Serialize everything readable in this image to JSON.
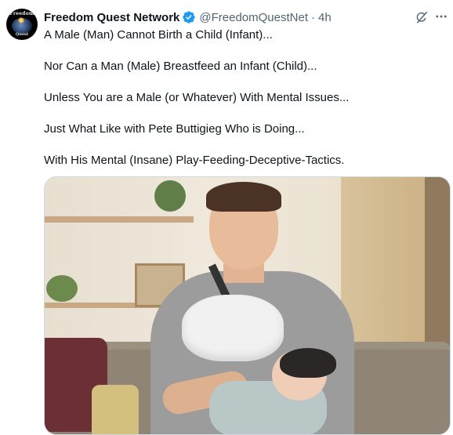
{
  "tweet": {
    "author": {
      "display_name": "Freedom Quest Network",
      "handle": "@FreedomQuestNet",
      "verified_badge_color": "#1d9bf0",
      "avatar_text_top": "Freedom",
      "avatar_text_bottom": "Quest"
    },
    "separator": "·",
    "timestamp": "4h",
    "icons": [
      "verified-badge-icon",
      "grok-icon",
      "more-options-icon"
    ],
    "lines": [
      "A Male (Man) Cannot Birth a Child (Infant)...",
      "Nor Can a Man (Male) Breastfeed an Infant (Child)...",
      "Unless You are a Male (or Whatever) With Mental Issues...",
      "Just What Like with Pete Buttigieg Who is Doing...",
      "With His Mental (Insane) Play-Feeding-Deceptive-Tactics."
    ]
  },
  "colors": {
    "text_primary": "#0f1419",
    "text_secondary": "#536471",
    "border": "#cfd9de"
  }
}
